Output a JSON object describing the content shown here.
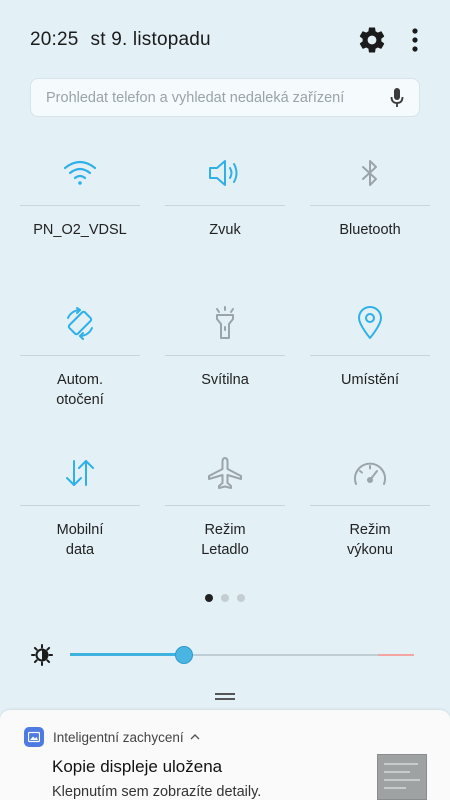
{
  "status": {
    "time": "20:25",
    "date": "st 9. listopadu"
  },
  "search": {
    "placeholder": "Prohledat telefon a vyhledat nedaleká zařízení"
  },
  "tiles": [
    {
      "label": "PN_O2_VDSL",
      "icon": "wifi-icon",
      "active": true
    },
    {
      "label": "Zvuk",
      "icon": "speaker-icon",
      "active": true
    },
    {
      "label": "Bluetooth",
      "icon": "bluetooth-icon",
      "active": false
    },
    {
      "label": "Autom.\notočení",
      "icon": "auto-rotate-icon",
      "active": true
    },
    {
      "label": "Svítilna",
      "icon": "flashlight-icon",
      "active": false
    },
    {
      "label": "Umístění",
      "icon": "location-icon",
      "active": true
    },
    {
      "label": "Mobilní\ndata",
      "icon": "mobile-data-icon",
      "active": true
    },
    {
      "label": "Režim\nLetadlo",
      "icon": "airplane-icon",
      "active": false
    },
    {
      "label": "Režim\nvýkonu",
      "icon": "performance-gauge-icon",
      "active": false
    }
  ],
  "pager": {
    "pages": 3,
    "current": 1
  },
  "brightness": {
    "level": 0.33
  },
  "notification": {
    "app_name": "Inteligentní zachycení",
    "title": "Kopie displeje uložena",
    "body": "Klepnutím sem zobrazíte detaily."
  },
  "colors": {
    "panel_background": "#e3f0f6",
    "active_icon": "#2fb0e8",
    "inactive_icon": "#9aa4aa",
    "slider_fill": "#3fb2e0",
    "notification_app_icon": "#4d7be0"
  }
}
